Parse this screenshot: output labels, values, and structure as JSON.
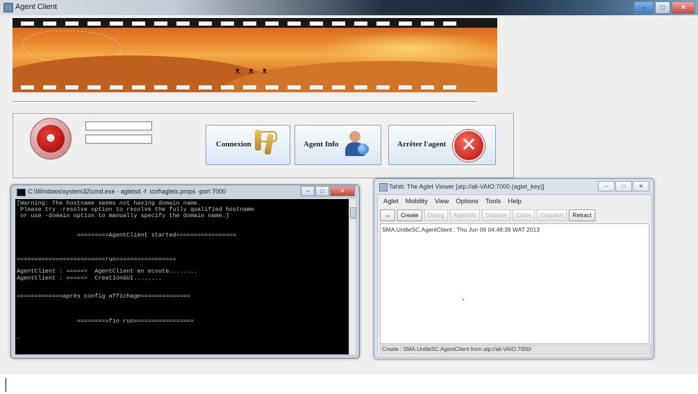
{
  "window": {
    "title": "Agent Client",
    "controls": [
      "minimize",
      "maximize",
      "close"
    ]
  },
  "login": {
    "field1_value": "",
    "field2_value": ""
  },
  "buttons": {
    "connect": "Connexion",
    "agent_info": "Agent Info",
    "stop_agent": "Arrêter l'agent"
  },
  "cmd": {
    "title": "C:\\Windows\\system32\\cmd.exe - agletsd  -f .\\cnf\\aglets.props -port 7000",
    "lines": [
      "[Warning: The hostname seems not having domain name.",
      " Please try -resolve option to resolve the fully qualified hostname",
      " or use -domain option to manually specify the domain name.]",
      "                 =========AgentClient started=================",
      "=========================run=================",
      "AgentClient : =====>  AgentClient en ecoute........",
      "AgentClient : =====>  CreationGUI........",
      "=============après config affichage==============",
      "                 =========fin run=================",
      "_"
    ]
  },
  "tahiti": {
    "title": "Tahiti: The Aglet Viewer [atp://ali-VAIO:7000 (aglet_key)]",
    "menu": [
      "Aglet",
      "Mobility",
      "View",
      "Options",
      "Tools",
      "Help"
    ],
    "toolbar": {
      "icon_btn": "↔",
      "create": "Create",
      "dialog": "Dialog",
      "aglet_info": "AgletInfo",
      "dispose": "Dispose",
      "clone": "Clone",
      "dispatch": "Dispatch",
      "retract": "Retract"
    },
    "list_item": "SMA.UnitleSC.AgentClient : Thu Jun 06 04:48:39 WAT 2013",
    "status": "Create : SMA.UnitleSC.AgentClient from atp://ali-VAIO:7000/"
  }
}
